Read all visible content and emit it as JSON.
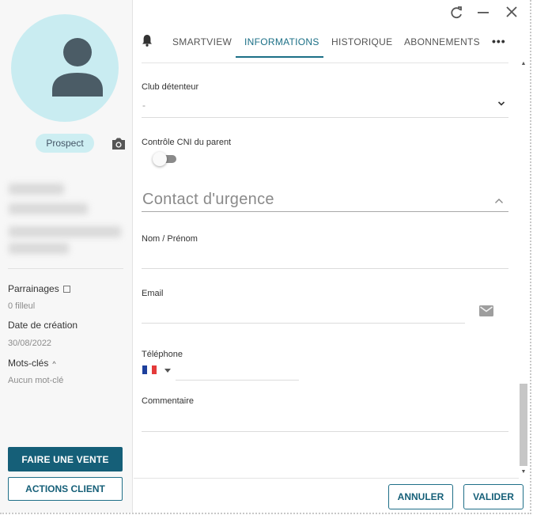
{
  "left_panel": {
    "status_badge": "Prospect",
    "parrainages_label": "Parrainages",
    "filleuls_value": "0 filleul",
    "date_creation_label": "Date de création",
    "date_creation_value": "30/08/2022",
    "mots_cles_label": "Mots-clés",
    "mots_cles_value": "Aucun mot-clé",
    "sell_button": "FAIRE UNE VENTE",
    "actions_button": "ACTIONS CLIENT"
  },
  "tabs": [
    {
      "label": "SMARTVIEW",
      "active": false
    },
    {
      "label": "INFORMATIONS",
      "active": true
    },
    {
      "label": "HISTORIQUE",
      "active": false
    },
    {
      "label": "ABONNEMENTS",
      "active": false
    }
  ],
  "more_tabs": "•••",
  "window_controls": {
    "refresh": "C",
    "minimize": "—",
    "close": "✕"
  },
  "form": {
    "club_label": "Club détenteur",
    "club_value": "-",
    "cni_label": "Contrôle CNI du parent",
    "cni_checked": false,
    "section_title": "Contact d'urgence",
    "nom_label": "Nom / Prénom",
    "nom_value": "",
    "email_label": "Email",
    "email_value": "",
    "telephone_label": "Téléphone",
    "telephone_value": "",
    "commentaire_label": "Commentaire",
    "commentaire_value": ""
  },
  "footer": {
    "cancel": "ANNULER",
    "validate": "VALIDER"
  },
  "colors": {
    "primary": "#155f78",
    "accent_tab": "#1b6f86",
    "avatar_bg": "#c9ecf1",
    "avatar_figure": "#4b5c66"
  },
  "icons": [
    "refresh-icon",
    "minimize-icon",
    "close-icon",
    "bell-icon",
    "camera-icon",
    "external-link-icon",
    "chevron-down-icon",
    "chevron-up-icon",
    "mail-icon",
    "france-flag-icon"
  ]
}
